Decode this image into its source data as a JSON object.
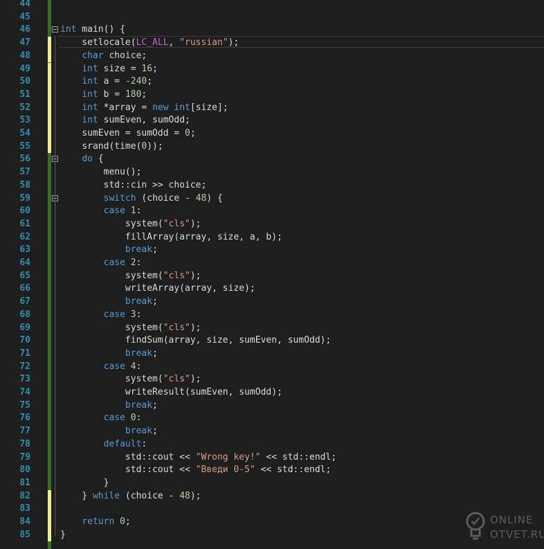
{
  "editor": {
    "lines": [
      {
        "n": "44",
        "parts": []
      },
      {
        "n": "45",
        "parts": []
      },
      {
        "n": "46",
        "parts": [
          [
            "kw",
            "int"
          ],
          [
            "t",
            " main() {"
          ]
        ]
      },
      {
        "n": "47",
        "parts": [
          [
            "t",
            "    setlocale("
          ],
          [
            "mac",
            "LC_ALL"
          ],
          [
            "t",
            ", "
          ],
          [
            "str",
            "\"russian\""
          ],
          [
            "t",
            ");"
          ]
        ]
      },
      {
        "n": "48",
        "parts": [
          [
            "t",
            "    "
          ],
          [
            "kw",
            "char"
          ],
          [
            "t",
            " choice;"
          ]
        ]
      },
      {
        "n": "49",
        "parts": [
          [
            "t",
            "    "
          ],
          [
            "kw",
            "int"
          ],
          [
            "t",
            " size = "
          ],
          [
            "num",
            "16"
          ],
          [
            "t",
            ";"
          ]
        ]
      },
      {
        "n": "50",
        "parts": [
          [
            "t",
            "    "
          ],
          [
            "kw",
            "int"
          ],
          [
            "t",
            " a = "
          ],
          [
            "num",
            "-240"
          ],
          [
            "t",
            ";"
          ]
        ]
      },
      {
        "n": "51",
        "parts": [
          [
            "t",
            "    "
          ],
          [
            "kw",
            "int"
          ],
          [
            "t",
            " b = "
          ],
          [
            "num",
            "180"
          ],
          [
            "t",
            ";"
          ]
        ]
      },
      {
        "n": "52",
        "parts": [
          [
            "t",
            "    "
          ],
          [
            "kw",
            "int"
          ],
          [
            "t",
            " *array = "
          ],
          [
            "kw",
            "new"
          ],
          [
            "t",
            " "
          ],
          [
            "kw",
            "int"
          ],
          [
            "t",
            "[size];"
          ]
        ]
      },
      {
        "n": "53",
        "parts": [
          [
            "t",
            "    "
          ],
          [
            "kw",
            "int"
          ],
          [
            "t",
            " sumEven, sumOdd;"
          ]
        ]
      },
      {
        "n": "54",
        "parts": [
          [
            "t",
            "    sumEven = sumOdd = "
          ],
          [
            "num",
            "0"
          ],
          [
            "t",
            ";"
          ]
        ]
      },
      {
        "n": "55",
        "parts": [
          [
            "t",
            "    srand(time("
          ],
          [
            "num",
            "0"
          ],
          [
            "t",
            "));"
          ]
        ]
      },
      {
        "n": "56",
        "parts": [
          [
            "t",
            "    "
          ],
          [
            "kw",
            "do"
          ],
          [
            "t",
            " {"
          ]
        ]
      },
      {
        "n": "57",
        "parts": [
          [
            "t",
            "        menu();"
          ]
        ]
      },
      {
        "n": "58",
        "parts": [
          [
            "t",
            "        std::cin >> choice;"
          ]
        ]
      },
      {
        "n": "59",
        "parts": [
          [
            "t",
            "        "
          ],
          [
            "kw",
            "switch"
          ],
          [
            "t",
            " (choice - "
          ],
          [
            "num",
            "48"
          ],
          [
            "t",
            ") {"
          ]
        ]
      },
      {
        "n": "60",
        "parts": [
          [
            "t",
            "        "
          ],
          [
            "kw",
            "case"
          ],
          [
            "t",
            " "
          ],
          [
            "num",
            "1"
          ],
          [
            "t",
            ":"
          ]
        ]
      },
      {
        "n": "61",
        "parts": [
          [
            "t",
            "            system("
          ],
          [
            "str",
            "\"cls\""
          ],
          [
            "t",
            ");"
          ]
        ]
      },
      {
        "n": "62",
        "parts": [
          [
            "t",
            "            fillArray(array, size, a, b);"
          ]
        ]
      },
      {
        "n": "63",
        "parts": [
          [
            "t",
            "            "
          ],
          [
            "kw",
            "break"
          ],
          [
            "t",
            ";"
          ]
        ]
      },
      {
        "n": "64",
        "parts": [
          [
            "t",
            "        "
          ],
          [
            "kw",
            "case"
          ],
          [
            "t",
            " "
          ],
          [
            "num",
            "2"
          ],
          [
            "t",
            ":"
          ]
        ]
      },
      {
        "n": "65",
        "parts": [
          [
            "t",
            "            system("
          ],
          [
            "str",
            "\"cls\""
          ],
          [
            "t",
            ");"
          ]
        ]
      },
      {
        "n": "66",
        "parts": [
          [
            "t",
            "            writeArray(array, size);"
          ]
        ]
      },
      {
        "n": "67",
        "parts": [
          [
            "t",
            "            "
          ],
          [
            "kw",
            "break"
          ],
          [
            "t",
            ";"
          ]
        ]
      },
      {
        "n": "68",
        "parts": [
          [
            "t",
            "        "
          ],
          [
            "kw",
            "case"
          ],
          [
            "t",
            " "
          ],
          [
            "num",
            "3"
          ],
          [
            "t",
            ":"
          ]
        ]
      },
      {
        "n": "69",
        "parts": [
          [
            "t",
            "            system("
          ],
          [
            "str",
            "\"cls\""
          ],
          [
            "t",
            ");"
          ]
        ]
      },
      {
        "n": "70",
        "parts": [
          [
            "t",
            "            findSum(array, size, sumEven, sumOdd);"
          ]
        ]
      },
      {
        "n": "71",
        "parts": [
          [
            "t",
            "            "
          ],
          [
            "kw",
            "break"
          ],
          [
            "t",
            ";"
          ]
        ]
      },
      {
        "n": "72",
        "parts": [
          [
            "t",
            "        "
          ],
          [
            "kw",
            "case"
          ],
          [
            "t",
            " "
          ],
          [
            "num",
            "4"
          ],
          [
            "t",
            ":"
          ]
        ]
      },
      {
        "n": "73",
        "parts": [
          [
            "t",
            "            system("
          ],
          [
            "str",
            "\"cls\""
          ],
          [
            "t",
            ");"
          ]
        ]
      },
      {
        "n": "74",
        "parts": [
          [
            "t",
            "            writeResult(sumEven, sumOdd);"
          ]
        ]
      },
      {
        "n": "75",
        "parts": [
          [
            "t",
            "            "
          ],
          [
            "kw",
            "break"
          ],
          [
            "t",
            ";"
          ]
        ]
      },
      {
        "n": "76",
        "parts": [
          [
            "t",
            "        "
          ],
          [
            "kw",
            "case"
          ],
          [
            "t",
            " "
          ],
          [
            "num",
            "0"
          ],
          [
            "t",
            ":"
          ]
        ]
      },
      {
        "n": "77",
        "parts": [
          [
            "t",
            "            "
          ],
          [
            "kw",
            "break"
          ],
          [
            "t",
            ";"
          ]
        ]
      },
      {
        "n": "78",
        "parts": [
          [
            "t",
            "        "
          ],
          [
            "kw",
            "default"
          ],
          [
            "t",
            ":"
          ]
        ]
      },
      {
        "n": "79",
        "parts": [
          [
            "t",
            "            std::cout << "
          ],
          [
            "str",
            "\"Wrong key!\""
          ],
          [
            "t",
            " << std::endl;"
          ]
        ]
      },
      {
        "n": "80",
        "parts": [
          [
            "t",
            "            std::cout << "
          ],
          [
            "str",
            "\"Введи 0-5\""
          ],
          [
            "t",
            " << std::endl;"
          ]
        ]
      },
      {
        "n": "81",
        "parts": [
          [
            "t",
            "        }"
          ]
        ]
      },
      {
        "n": "82",
        "parts": [
          [
            "t",
            "    } "
          ],
          [
            "kw",
            "while"
          ],
          [
            "t",
            " (choice - "
          ],
          [
            "num",
            "48"
          ],
          [
            "t",
            ");"
          ]
        ]
      },
      {
        "n": "83",
        "parts": []
      },
      {
        "n": "84",
        "parts": [
          [
            "t",
            "    "
          ],
          [
            "kw",
            "return"
          ],
          [
            "t",
            " "
          ],
          [
            "num",
            "0"
          ],
          [
            "t",
            ";"
          ]
        ]
      },
      {
        "n": "85",
        "parts": [
          [
            "t",
            "}"
          ]
        ]
      }
    ],
    "yellow_change_lines": [
      "47",
      "48",
      "49",
      "50",
      "51",
      "52",
      "53",
      "54",
      "55",
      "82",
      "83",
      "84",
      "85"
    ],
    "fold_lines": [
      "46",
      "56",
      "59"
    ],
    "colors": {
      "background": "#1e1e1e",
      "line_number": "#2b91af",
      "keyword": "#569cd6",
      "string": "#d69d85",
      "number": "#b5cea8",
      "macro": "#bd63c5",
      "text": "#dcdcdc",
      "change_saved": "#3c6b29",
      "change_unsaved": "#efef91"
    }
  },
  "watermark": {
    "line1": "ONLINE",
    "line2": "OTVET.RU",
    "icon": "lightbulb-icon"
  }
}
